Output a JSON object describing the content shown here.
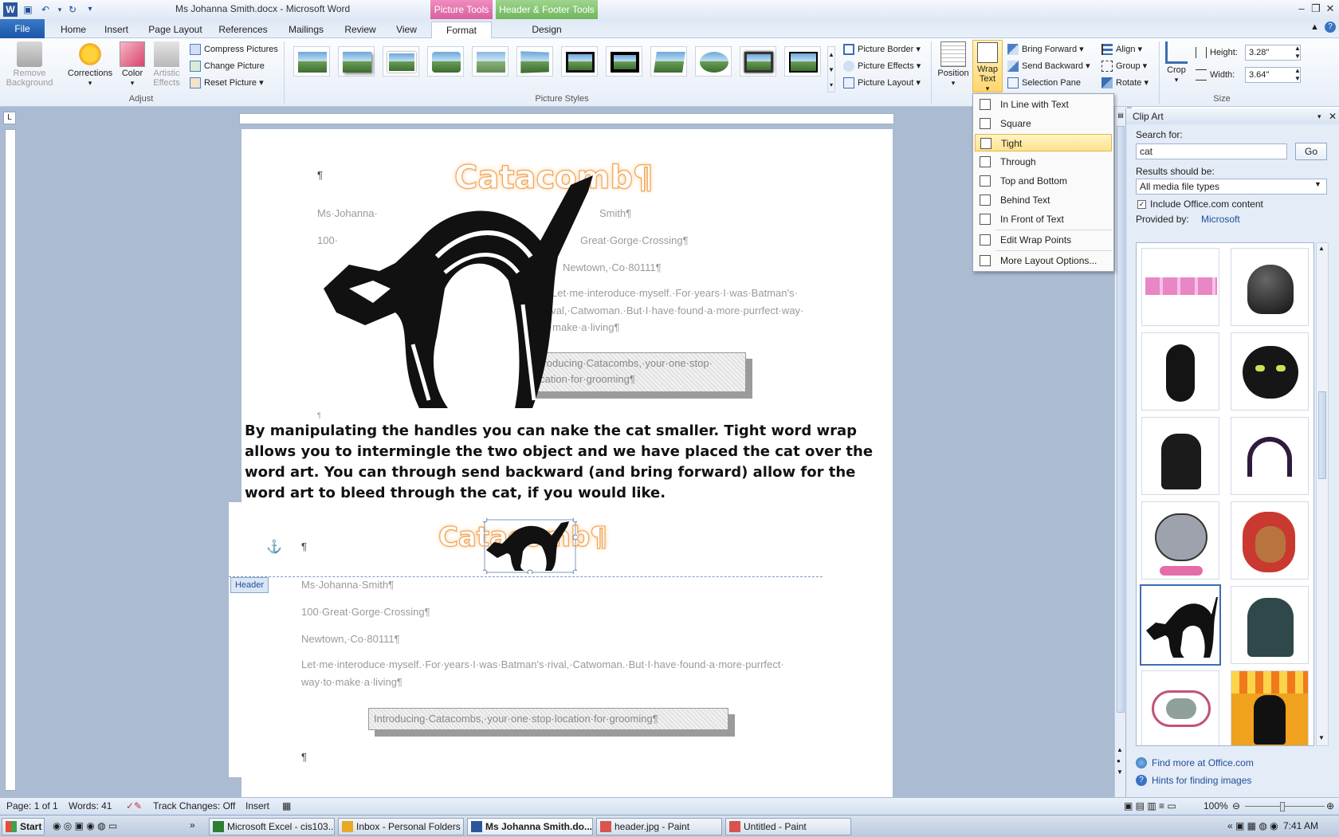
{
  "window": {
    "title": "Ms Johanna Smith.docx - Microsoft Word",
    "picture_tools_label": "Picture Tools",
    "header_footer_tools_label": "Header & Footer Tools"
  },
  "tabs": [
    "File",
    "Home",
    "Insert",
    "Page Layout",
    "References",
    "Mailings",
    "Review",
    "View",
    "Format",
    "Design"
  ],
  "ribbon": {
    "adjust": {
      "remove_background": "Remove Background",
      "corrections": "Corrections",
      "color": "Color",
      "artistic_effects": "Artistic Effects",
      "compress_pictures": "Compress Pictures",
      "change_picture": "Change Picture",
      "reset_picture": "Reset Picture",
      "group_label": "Adjust"
    },
    "picture_styles": {
      "group_label": "Picture Styles",
      "picture_border": "Picture Border",
      "picture_effects": "Picture Effects",
      "picture_layout": "Picture Layout"
    },
    "arrange": {
      "position": "Position",
      "wrap_text": "Wrap Text",
      "bring_forward": "Bring Forward",
      "send_backward": "Send Backward",
      "selection_pane": "Selection Pane",
      "align": "Align",
      "group": "Group",
      "rotate": "Rotate"
    },
    "size": {
      "crop": "Crop",
      "height_label": "Height:",
      "height_value": "3.28\"",
      "width_label": "Width:",
      "width_value": "3.64\"",
      "group_label": "Size"
    }
  },
  "wrap_menu": {
    "items": [
      "In Line with Text",
      "Square",
      "Tight",
      "Through",
      "Top and Bottom",
      "Behind Text",
      "In Front of Text",
      "Edit Wrap Points",
      "More Layout Options..."
    ],
    "selected": "Tight"
  },
  "document": {
    "wordart": "Catacomb¶",
    "name_line_a": "Ms·Johanna·",
    "name_line_b": "Smith¶",
    "addr_a": "100·",
    "addr_b": "Great·Gorge·Crossing¶",
    "city": "Newtown,·Co·80111¶",
    "intro_1": "Let·me·interoduce·myself.·For·years·I·was·Batman's·",
    "intro_2": "rival,·Catwoman.·But·I·have·found·a·more·purrfect·way·",
    "intro_3": "to·make·a·living¶",
    "textbox_1": "Introducing·Catacombs,·your·one·stop·",
    "textbox_2": "location·for·grooming¶",
    "pilcrow": "¶",
    "body_paragraph": "By manipulating the handles you can nake the cat smaller. Tight word wrap allows you to intermingle the two object and we have placed the cat over the word art. You can through send backward (and bring forward) allow for the word art to bleed through the cat, if you would like.",
    "header_tag": "Header",
    "h_name": "Ms·Johanna·Smith¶",
    "h_addr": "100·Great·Gorge·Crossing¶",
    "h_city": "Newtown,·Co·80111¶",
    "h_intro_1": "Let·me·interoduce·myself.·For·years·I·was·Batman's·rival,·Catwoman.·But·I·have·found·a·more·purrfect·",
    "h_intro_2": "way·to·make·a·living¶",
    "h_textbox": "Introducing·Catacombs,·your·one·stop·location·for·grooming¶"
  },
  "clipart": {
    "title": "Clip Art",
    "search_label": "Search for:",
    "search_value": "cat",
    "go_label": "Go",
    "results_label": "Results should be:",
    "results_value": "All media file types",
    "include_label": "Include Office.com content",
    "include_checked": true,
    "provided_label": "Provided by:",
    "provided_value": "Microsoft",
    "find_more": "Find more at Office.com",
    "hints": "Hints for finding images"
  },
  "statusbar": {
    "page": "Page: 1 of 1",
    "words": "Words: 41",
    "track_changes": "Track Changes: Off",
    "mode": "Insert",
    "zoom": "100%"
  },
  "taskbar": {
    "start": "Start",
    "items": [
      "Microsoft Excel - cis103....",
      "Inbox - Personal Folders ...",
      "Ms Johanna Smith.do...",
      "header.jpg - Paint",
      "Untitled - Paint"
    ],
    "active_index": 2,
    "clock": "7:41 AM"
  },
  "colors": {
    "accent": "#2b579a",
    "picture_tools": "#e26fa9",
    "header_footer_tools": "#7cc06a",
    "wordart_outline": "#f1a45a"
  }
}
